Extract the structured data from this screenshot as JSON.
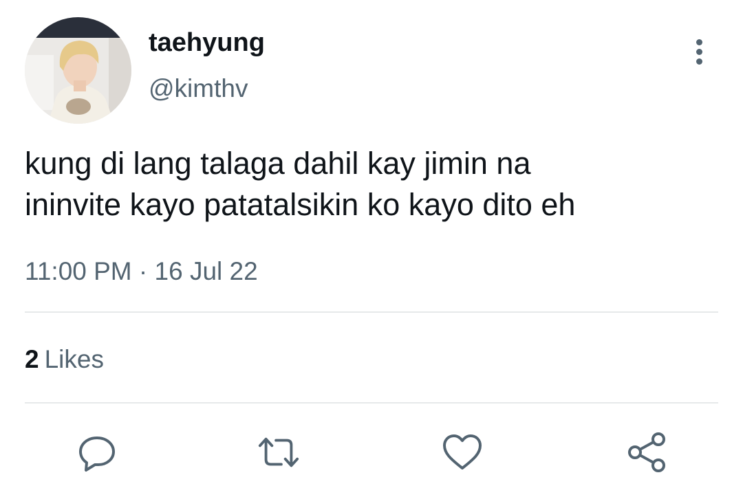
{
  "tweet": {
    "author": {
      "display_name": "taehyung",
      "handle": "@kimthv"
    },
    "text_lines": [
      "kung di lang talaga dahil kay jimin na",
      "ininvite kayo patatalsikin ko kayo dito eh"
    ],
    "timestamp": "11:00 PM · 16 Jul 22",
    "likes": {
      "count": "2",
      "label": "Likes"
    }
  },
  "actions": [
    {
      "name": "reply",
      "icon": "reply-icon"
    },
    {
      "name": "retweet",
      "icon": "retweet-icon"
    },
    {
      "name": "like",
      "icon": "heart-icon"
    },
    {
      "name": "share",
      "icon": "share-icon"
    }
  ],
  "colors": {
    "text_primary": "#0f1419",
    "text_secondary": "#536471",
    "divider": "#e6e9ea",
    "icon": "#536471"
  }
}
